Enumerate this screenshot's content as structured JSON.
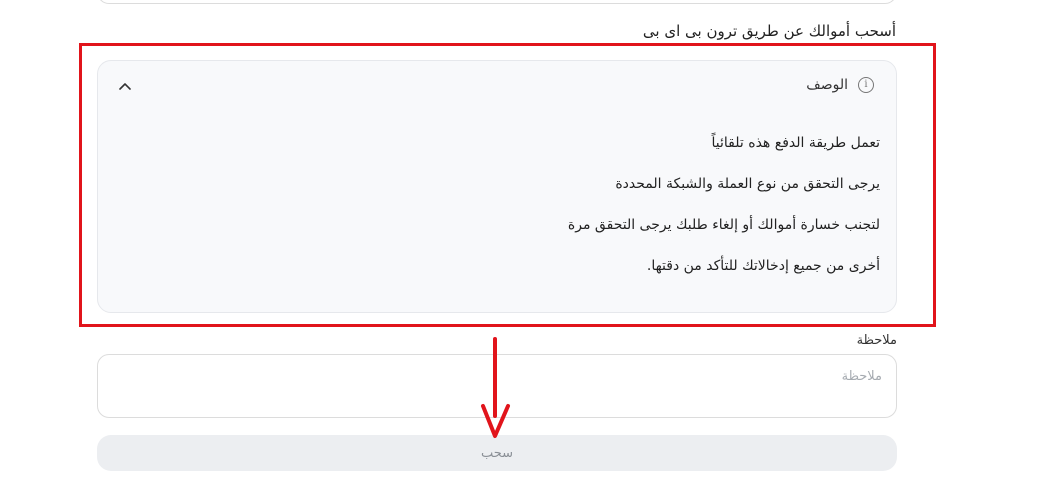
{
  "section": {
    "title": "أسحب أموالك عن طريق ترون بی ای بی"
  },
  "description": {
    "label": "الوصف",
    "info_icon": "info-icon",
    "collapse_icon": "chevron-up-icon",
    "lines": [
      "تعمل طريقة الدفع هذه تلقائياً",
      "يرجى التحقق من نوع العملة والشبكة المحددة",
      "لتجنب خسارة أموالك أو إلغاء طلبك يرجى التحقق مرة",
      "أخرى من جميع إدخالاتك للتأكد من دقتها."
    ]
  },
  "note": {
    "label": "ملاحظة",
    "placeholder": "ملاحظة",
    "value": ""
  },
  "submit": {
    "label": "سحب"
  },
  "annotation": {
    "highlight_color": "#e1141b",
    "arrow_color": "#e1141b"
  }
}
